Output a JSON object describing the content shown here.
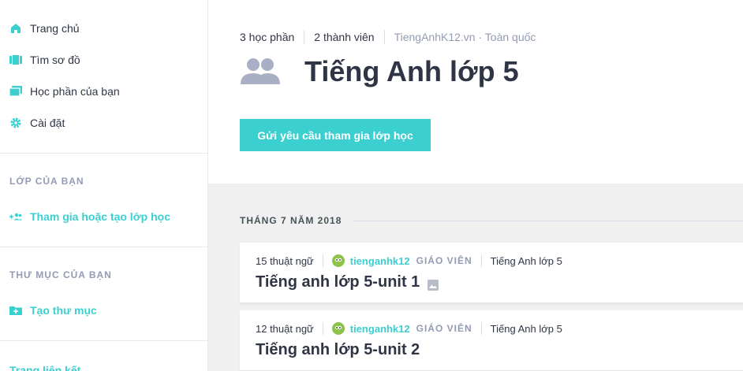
{
  "sidebar": {
    "nav": [
      {
        "label": "Trang chủ",
        "icon": "home-icon"
      },
      {
        "label": "Tìm sơ đồ",
        "icon": "cards-icon"
      },
      {
        "label": "Học phần của bạn",
        "icon": "study-sets-icon"
      },
      {
        "label": "Cài đặt",
        "icon": "gear-icon"
      }
    ],
    "classes_heading": "LỚP CỦA BẠN",
    "join_class_label": "Tham gia hoặc tạo lớp học",
    "folders_heading": "THƯ MỤC CỦA BẠN",
    "create_folder_label": "Tạo thư mục",
    "partial_label": "Trang liên kết"
  },
  "header": {
    "set_count": "3 học phần",
    "member_count": "2 thành viên",
    "school": "TiengAnhK12.vn · Toàn quốc",
    "title": "Tiếng Anh lớp 5",
    "join_button": "Gửi yêu cầu tham gia lớp học"
  },
  "content": {
    "month": "THÁNG 7 NĂM 2018",
    "sets": [
      {
        "terms": "15 thuật ngữ",
        "author": "tienganhk12",
        "role": "GIÁO VIÊN",
        "class": "Tiếng Anh lớp 5",
        "title": "Tiếng anh lớp 5-unit 1",
        "has_image": true
      },
      {
        "terms": "12 thuật ngữ",
        "author": "tienganhk12",
        "role": "GIÁO VIÊN",
        "class": "Tiếng Anh lớp 5",
        "title": "Tiếng anh lớp 5-unit 2",
        "has_image": false
      }
    ]
  },
  "colors": {
    "accent": "#3ccfcf",
    "text": "#303545",
    "muted": "#939bb4",
    "content_bg": "#f0f0f0"
  }
}
